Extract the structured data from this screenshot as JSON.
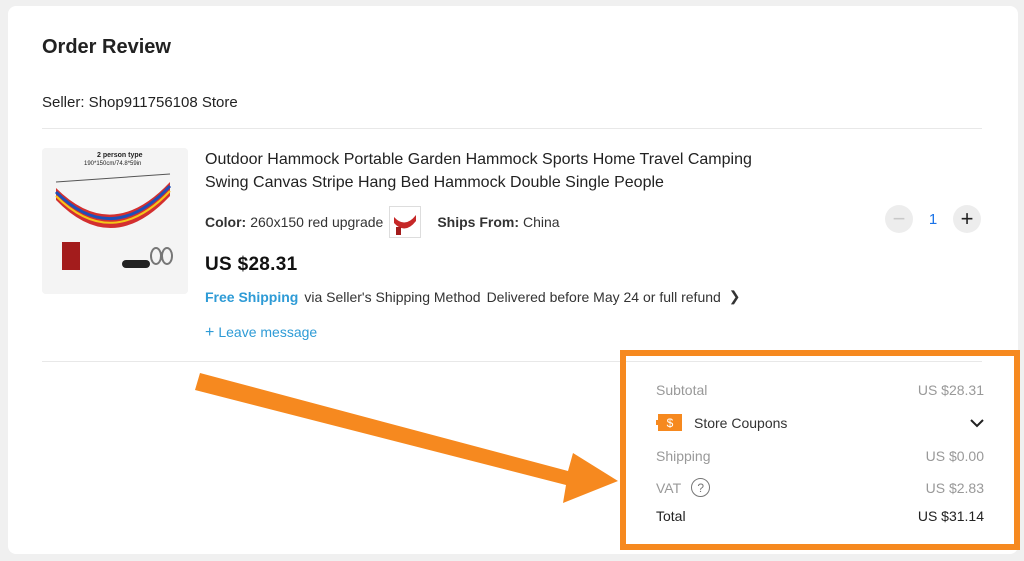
{
  "header": {
    "title": "Order Review",
    "seller": "Seller: Shop911756108 Store"
  },
  "product": {
    "title": "Outdoor Hammock Portable Garden Hammock Sports Home Travel Camping Swing Canvas Stripe Hang Bed Hammock Double Single People",
    "image_text_1": "2 person type",
    "image_text_2": "190*150cm/74.8*59in",
    "color_label": "Color:",
    "color_value": "260x150 red upgrade",
    "ships_label": "Ships From:",
    "ships_value": "China",
    "price": "US $28.31",
    "quantity": "1",
    "free_shipping": "Free Shipping",
    "shipping_method": "via Seller's Shipping Method",
    "delivery": "Delivered before May 24 or full refund",
    "leave_message": "Leave message"
  },
  "summary": {
    "subtotal_label": "Subtotal",
    "subtotal_value": "US $28.31",
    "coupon_label": "Store Coupons",
    "shipping_label": "Shipping",
    "shipping_value": "US $0.00",
    "vat_label": "VAT",
    "vat_value": "US $2.83",
    "total_label": "Total",
    "total_value": "US $31.14"
  },
  "colors": {
    "accent_orange": "#f6891f",
    "link_blue": "#2e9bd6",
    "qty_blue": "#1a73e8"
  },
  "icons": [
    "minus-icon",
    "plus-icon",
    "chevron-right-icon",
    "coupon-icon",
    "chevron-down-icon",
    "help-icon",
    "arrow-annotation"
  ]
}
